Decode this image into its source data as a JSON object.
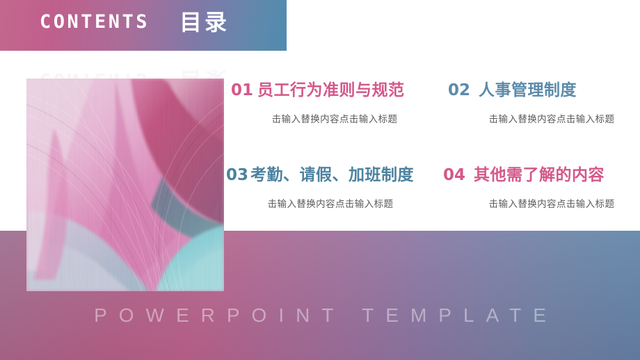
{
  "header": {
    "title_en": "CONTENTS",
    "title_cn": "目录"
  },
  "footer": {
    "brand_text": "POWERPOINT TEMPLATE"
  },
  "colors": {
    "accent_pink": "#d4588a",
    "accent_blue": "#5b8bab",
    "subtitle_gray": "#5a5a5a",
    "banner_start": "#c2688f",
    "banner_end": "#4f8bb0",
    "band_pink": "#b45e86",
    "band_blue": "#5286ab"
  },
  "photo": {
    "alt_name": "abstract-silk-texture",
    "palette": [
      "#f4c6e2",
      "#e27ab4",
      "#b9246b",
      "#8e2a5c",
      "#b9bcd8",
      "#8fd9de",
      "#5ec9d2"
    ]
  },
  "items": [
    {
      "num": "01",
      "title": "员工行为准则与规范",
      "subtitle": "击输入替换内容点击输入标题",
      "color": "#d4588a"
    },
    {
      "num": "02",
      "title": "人事管理制度",
      "subtitle": "击输入替换内容点击输入标题",
      "color": "#5b8bab"
    },
    {
      "num": "03",
      "title": "考勤、请假、加班制度",
      "subtitle": "击输入替换内容点击输入标题",
      "color": "#4c82a0"
    },
    {
      "num": "04",
      "title": "其他需了解的内容",
      "subtitle": "击输入替换内容点击输入标题",
      "color": "#d4588a"
    }
  ]
}
